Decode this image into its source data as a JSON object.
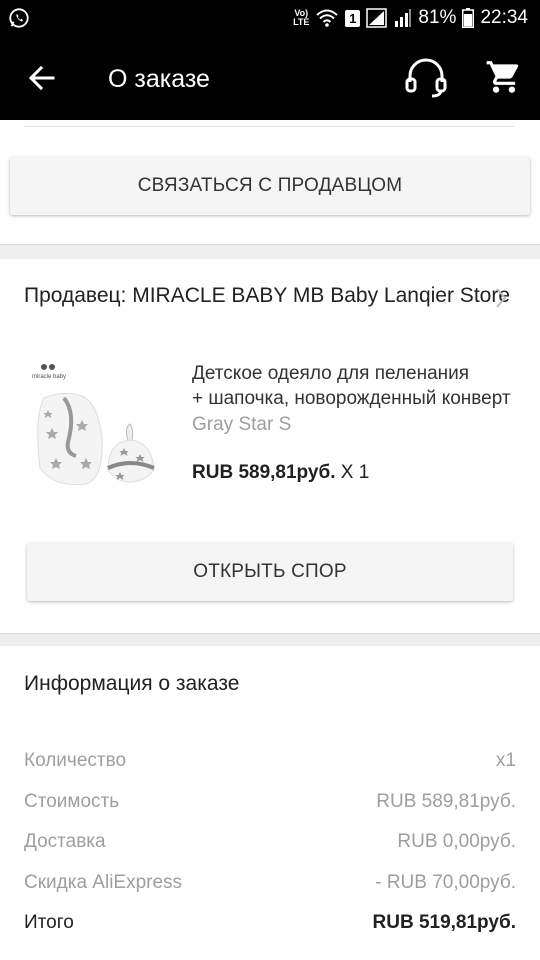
{
  "status_bar": {
    "volte_line1": "Vo)",
    "volte_line2": "LTE",
    "sim_badge": "1",
    "battery": "81%",
    "time": "22:34"
  },
  "app_bar": {
    "title": "О заказе"
  },
  "contact_seller_button": "СВЯЗАТЬСЯ С ПРОДАВЦОМ",
  "seller": {
    "label": "Продавец: MIRACLE BABY MB Baby Lanqier Store"
  },
  "product": {
    "name_line1": "Детское одеяло для пеленания",
    "name_line2": "+ шапочка, новорожденный конверт",
    "variant": "Gray Star S",
    "price": "RUB 589,81руб.",
    "quantity": " X 1",
    "thumb_brand": "miracle baby"
  },
  "open_dispute_button": "ОТКРЫТЬ СПОР",
  "order_info": {
    "title": "Информация о заказе",
    "rows": [
      {
        "label": "Количество",
        "value": "x1"
      },
      {
        "label": "Стоимость",
        "value": "RUB 589,81руб."
      },
      {
        "label": "Доставка",
        "value": "RUB 0,00руб."
      },
      {
        "label": "Скидка AliExpress",
        "value": "- RUB 70,00руб."
      },
      {
        "label": "Итого",
        "value": "RUB 519,81руб."
      }
    ]
  }
}
